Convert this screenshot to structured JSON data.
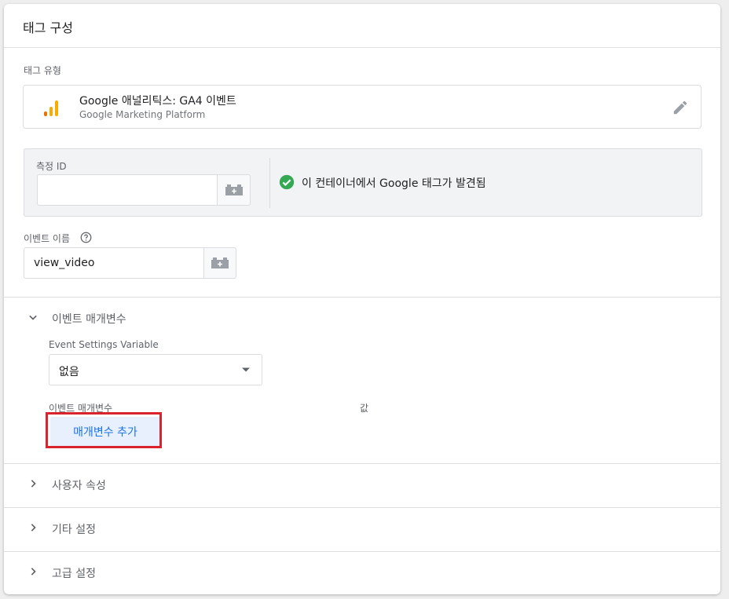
{
  "header": {
    "title": "태그 구성"
  },
  "tag_type": {
    "label": "태그 유형",
    "name": "Google 애널리틱스: GA4 이벤트",
    "provider": "Google Marketing Platform",
    "icon": "google-analytics-icon",
    "edit_icon": "pencil-icon"
  },
  "measurement": {
    "label": "측정 ID",
    "value": "",
    "variable_icon": "variable-brick-icon",
    "status_text": "이 컨테이너에서 Google 태그가 발견됨",
    "status_icon": "check-circle-icon",
    "status_color": "#34a853"
  },
  "event_name": {
    "label": "이벤트 이름",
    "help_icon": "help-circle-icon",
    "value": "view_video",
    "variable_icon": "variable-brick-icon"
  },
  "event_params": {
    "section_title": "이벤트 매개변수",
    "expanded": true,
    "settings_variable_label": "Event Settings Variable",
    "settings_variable_value": "없음",
    "col_param": "이벤트 매개변수",
    "col_value": "값",
    "add_button": "매개변수 추가"
  },
  "sections": [
    {
      "title": "사용자 속성"
    },
    {
      "title": "기타 설정"
    },
    {
      "title": "고급 설정"
    }
  ],
  "colors": {
    "accent": "#1a73e8",
    "highlight": "#d9232d",
    "ga_orange": "#f9ab00",
    "ga_dark_orange": "#e37400"
  }
}
